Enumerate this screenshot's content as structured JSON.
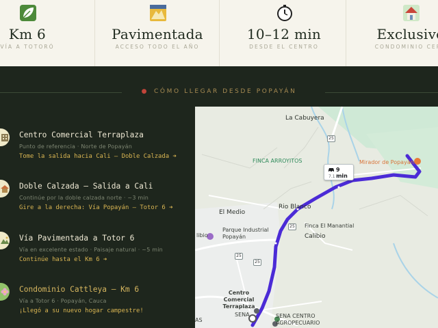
{
  "stats": [
    {
      "icon": "leaf-icon",
      "value": "Km 6",
      "sub": "VÍA A TOTORÓ"
    },
    {
      "icon": "road-icon",
      "value": "Pavimentada",
      "sub": "ACCESO TODO EL AÑO"
    },
    {
      "icon": "stopwatch-icon",
      "value": "10–12 min",
      "sub": "DESDE EL CENTRO"
    },
    {
      "icon": "house-icon",
      "value": "Exclusivo",
      "sub": "CONDOMINIO CERR"
    }
  ],
  "section": {
    "pin_icon": "location-pin-icon",
    "title": "CÓMO LLEGAR DESDE POPAYÁN"
  },
  "steps": [
    {
      "icon": "building-icon",
      "title": "Centro Comercial Terraplaza",
      "sub": "Punto de referencia · Norte de Popayán",
      "action": "Tome la salida hacia Cali — Doble Calzada ➜"
    },
    {
      "icon": "home-icon",
      "title": "Doble Calzada — Salida a Cali",
      "sub": "Continúe por la doble calzada norte · ~3 min",
      "action": "Gire a la derecha: Vía Popayán – Totor 6 ➜"
    },
    {
      "icon": "mountain-icon",
      "title": "Vía Pavimentada a Totor 6",
      "sub": "Vía en excelente estado · Paisaje natural · ~5 min",
      "action": "Continúe hasta el Km 6 ➜"
    },
    {
      "icon": "flower-icon",
      "title": "Condominio Cattleya — Km 6",
      "sub": "Vía a Totor 6 · Popayán, Cauca",
      "action": "¡Llegó a su nuevo hogar campestre!"
    }
  ],
  "map": {
    "labels": {
      "la_cabuyera": "La Cabuyera",
      "finca_arroyitos": "FINCA ARROYITOS",
      "mirador": "Mirador de Popayán",
      "rio_blanco": "Rio Blanco",
      "el_medio": "El Medio",
      "finca_manantial": "Finca El Manantial",
      "parque_industrial": "Parque Industrial Popayán",
      "calibio": "Calibio",
      "cc_terraplaza": "Centro Comercial Terraplaza",
      "sena": "SENA",
      "sena_centro": "SENA CENTRO AGROPECUARIO",
      "libio": "libio",
      "las": "AS"
    },
    "route_shields": [
      "25",
      "25",
      "25",
      "25"
    ],
    "eta": {
      "time": "9 min",
      "distance": "7.1 km"
    },
    "colors": {
      "route": "#4b2bd6",
      "water": "#a9d3e8",
      "roads": "#ffffff",
      "land": "#e9ece3"
    }
  }
}
